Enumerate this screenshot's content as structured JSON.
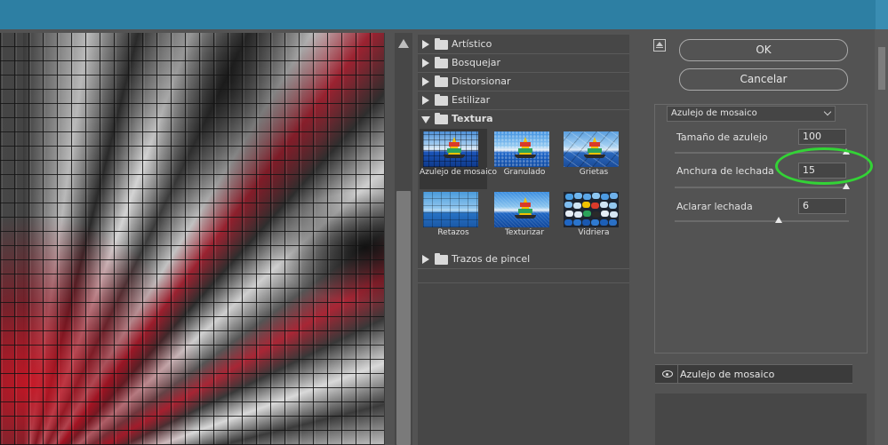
{
  "window": {
    "title": ""
  },
  "categories": {
    "top": [
      {
        "label": "Artístico"
      },
      {
        "label": "Bosquejar"
      },
      {
        "label": "Distorsionar"
      },
      {
        "label": "Estilizar"
      }
    ],
    "open": {
      "label": "Textura"
    },
    "thumbnails": [
      {
        "label": "Azulejo de mosaico",
        "selected": true
      },
      {
        "label": "Granulado",
        "selected": false
      },
      {
        "label": "Grietas",
        "selected": false
      },
      {
        "label": "Retazos",
        "selected": false
      },
      {
        "label": "Texturizar",
        "selected": false
      },
      {
        "label": "Vidriera",
        "selected": false
      }
    ],
    "bottom": [
      {
        "label": "Trazos de pincel"
      }
    ]
  },
  "buttons": {
    "ok": "OK",
    "cancel": "Cancelar"
  },
  "filter": {
    "selected": "Azulejo de mosaico"
  },
  "params": [
    {
      "label": "Tamaño de azulejo",
      "value": "100",
      "level": 1.0
    },
    {
      "label": "Anchura de lechada",
      "value": "15",
      "level": 1.0
    },
    {
      "label": "Aclarar lechada",
      "value": "6",
      "level": 0.6
    }
  ],
  "layers": [
    {
      "label": "Azulejo de mosaico",
      "visible": true
    }
  ],
  "colors": {
    "titlebar": "#2d7fa3",
    "highlight_ring": "#33d336",
    "panel": "#535353"
  }
}
